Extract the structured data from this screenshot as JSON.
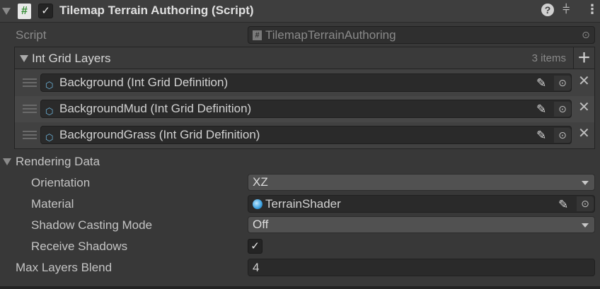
{
  "header": {
    "title": "Tilemap Terrain Authoring (Script)",
    "enabled": true,
    "script_icon": "#"
  },
  "script": {
    "label": "Script",
    "value": "TilemapTerrainAuthoring"
  },
  "list": {
    "title": "Int Grid Layers",
    "count": "3 items",
    "items": [
      {
        "label": "Background (Int Grid Definition)"
      },
      {
        "label": "BackgroundMud (Int Grid Definition)"
      },
      {
        "label": "BackgroundGrass (Int Grid Definition)"
      }
    ]
  },
  "rendering": {
    "title": "Rendering Data",
    "orientation": {
      "label": "Orientation",
      "value": "XZ"
    },
    "material": {
      "label": "Material",
      "value": "TerrainShader"
    },
    "shadow_casting": {
      "label": "Shadow Casting Mode",
      "value": "Off"
    },
    "receive_shadows": {
      "label": "Receive Shadows",
      "checked": true
    }
  },
  "max_layers": {
    "label": "Max Layers Blend",
    "value": "4"
  }
}
